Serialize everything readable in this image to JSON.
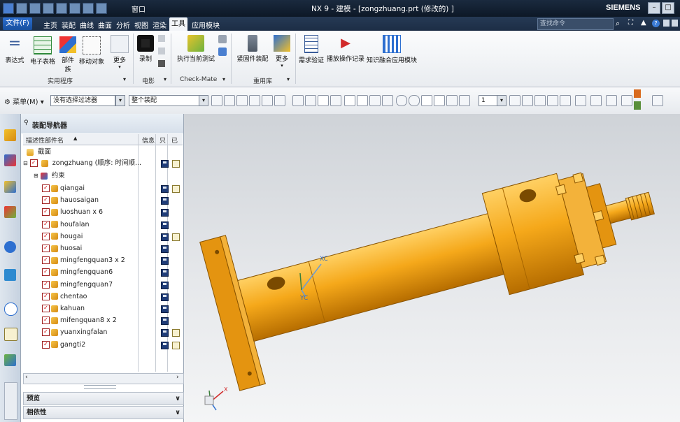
{
  "titlebar": {
    "window_menu": "窗口",
    "title": "NX 9 - 建模 - [zongzhuang.prt  (修改的) ]",
    "brand": "SIEMENS"
  },
  "menu": {
    "file": "文件(F)",
    "tabs": [
      "主页",
      "装配",
      "曲线",
      "曲面",
      "分析",
      "视图",
      "渲染",
      "工具",
      "应用模块"
    ],
    "active_tab": "工具",
    "search_placeholder": "查找命令"
  },
  "ribbon": {
    "buttons": [
      "表达式",
      "电子表格",
      "部件族",
      "移动对象",
      "更多",
      "录制",
      "执行当前测试",
      "紧固件装配",
      "更多",
      "需求验证",
      "播放操作记录",
      "知识融合应用模块"
    ],
    "groups": [
      "实用程序",
      "电影",
      "Check-Mate",
      "重用库"
    ]
  },
  "command_bar": {
    "menu_label": "菜单(M)",
    "filter_value": "没有选择过滤器",
    "scope_value": "整个装配",
    "count_value": "1"
  },
  "navigator": {
    "title": "装配导航器",
    "columns": [
      "描述性部件名",
      "信息",
      "只",
      "已"
    ],
    "section_label": "截面",
    "root": "zongzhuang (顺序: 时间顺...",
    "constraints": "约束",
    "parts": [
      "qiangai",
      "hauosaigan",
      "luoshuan x 6",
      "houfalan",
      "hougai",
      "huosai",
      "mingfengquan3 x 2",
      "mingfengquan6",
      "mingfengquan7",
      "chentao",
      "kahuan",
      "mifengquan8 x 2",
      "yuanxingfalan",
      "gangti2"
    ],
    "edit_marks": [
      true,
      false,
      false,
      false,
      true,
      false,
      false,
      false,
      false,
      false,
      false,
      false,
      true,
      true
    ],
    "preview_label": "预览",
    "dependency_label": "相依性"
  },
  "viewport": {
    "wcs_x": "XC",
    "wcs_y": "YC",
    "triad_x": "X",
    "part_color": "#f2a71a"
  }
}
